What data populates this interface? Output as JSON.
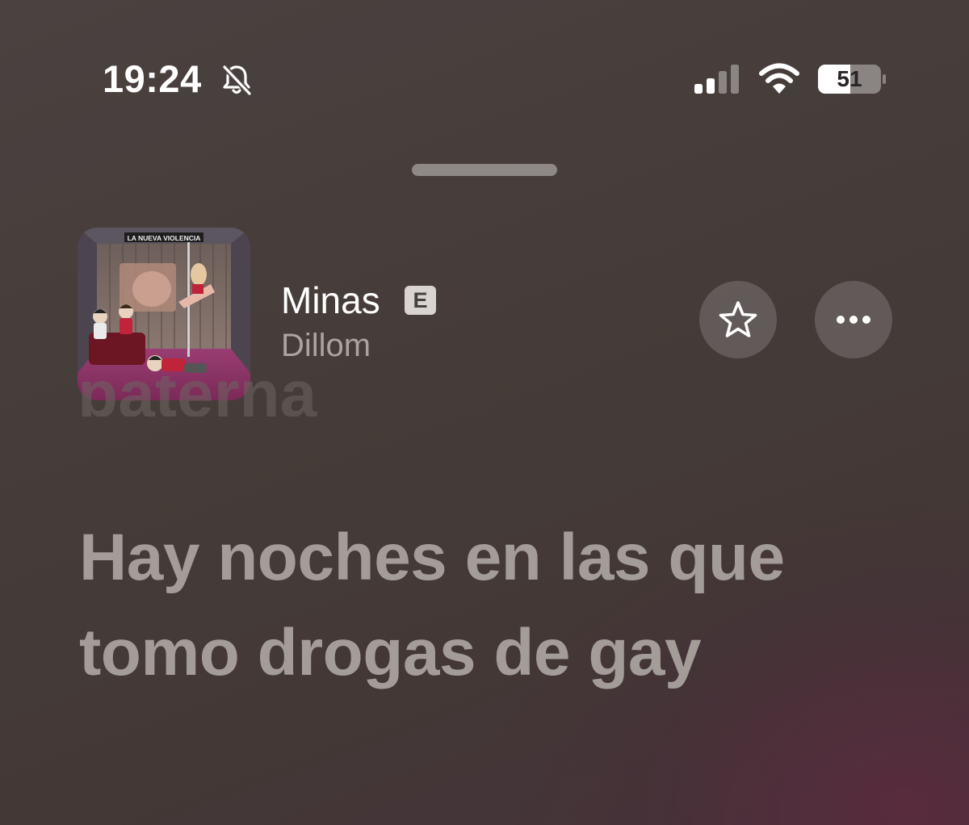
{
  "status_bar": {
    "time": "19:24",
    "battery_level": "51",
    "icons": [
      "bell-off-icon",
      "cellular-signal-icon",
      "wifi-icon",
      "battery-icon"
    ]
  },
  "now_playing": {
    "album_art_text": "LA NUEVA VIOLENCIA",
    "title": "Minas",
    "explicit_badge": "E",
    "artist": "Dillom",
    "buttons": [
      "star-icon",
      "more-icon"
    ]
  },
  "lyrics": {
    "previous_line_partial": "paterna",
    "current_line": "Hay noches en las que tomo drogas de gay"
  },
  "colors": {
    "background": "#443a38",
    "accent_glow": "#5c2a3e",
    "lyric_current": "#a49c99",
    "title": "#ffffff",
    "artist": "#aaa4a1"
  }
}
